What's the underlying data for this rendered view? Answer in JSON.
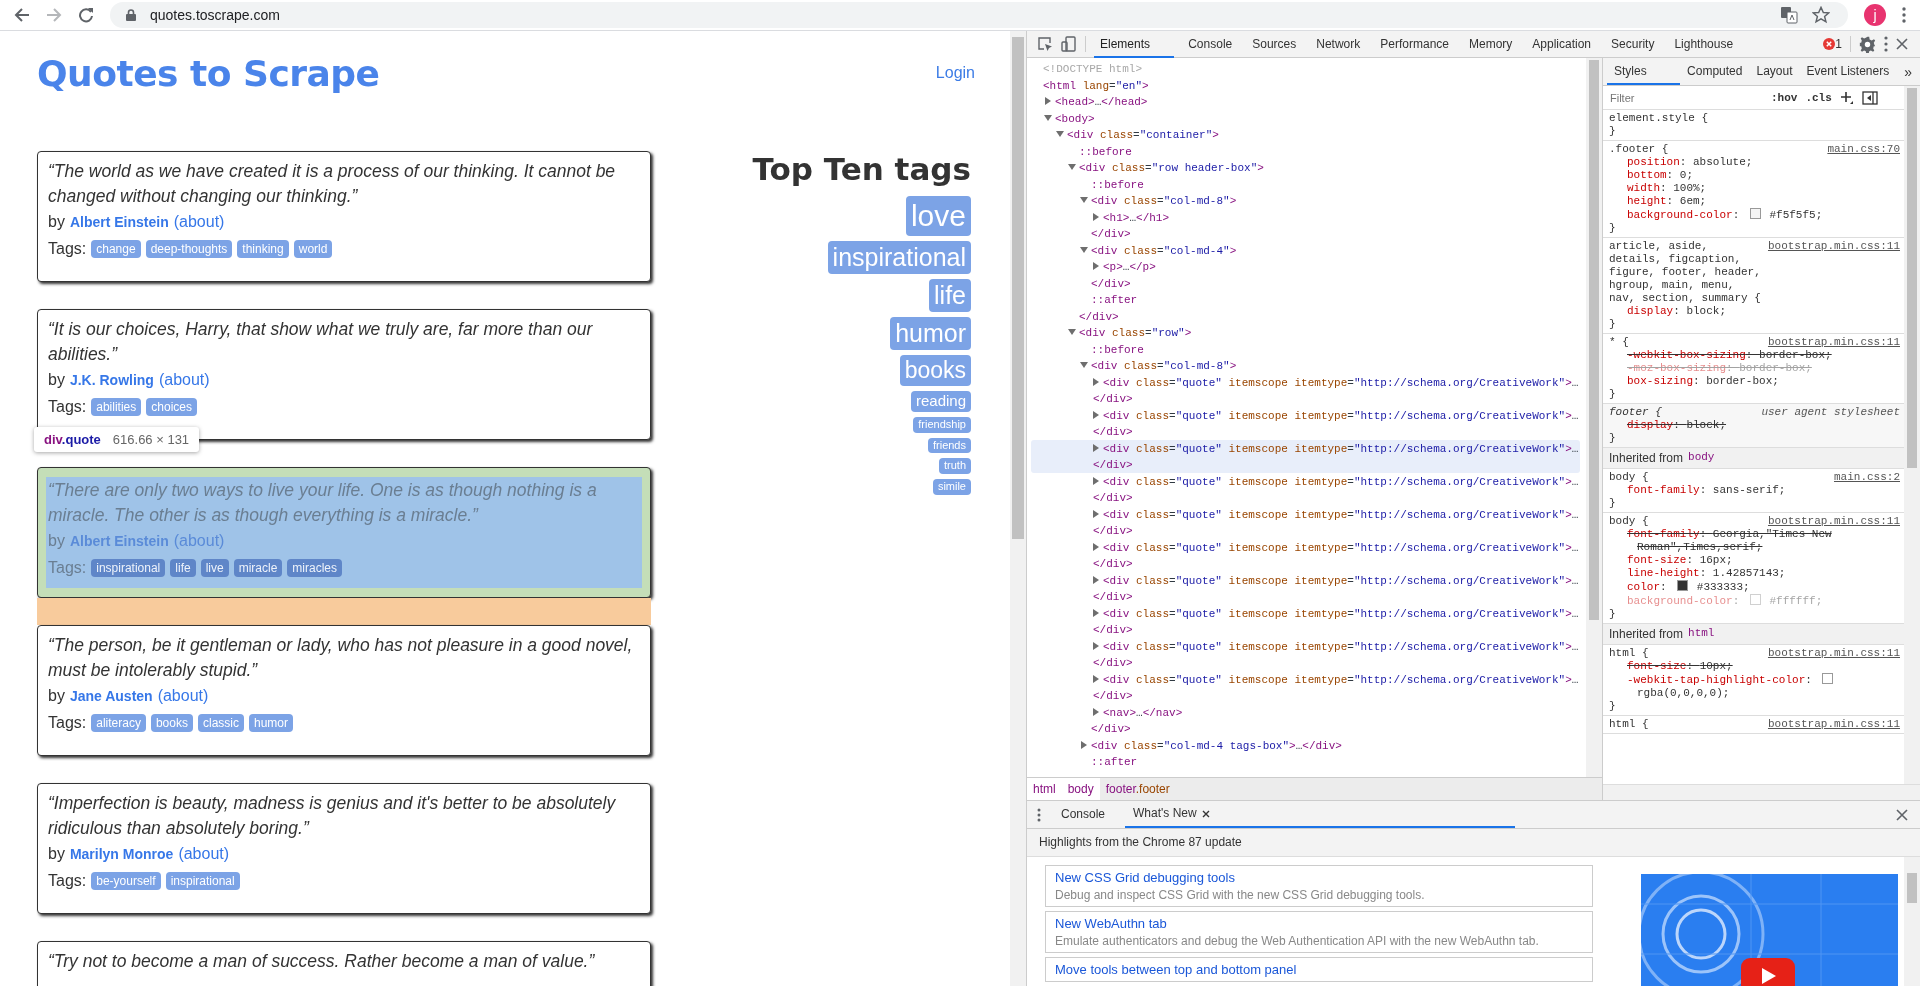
{
  "browser": {
    "nav_buttons": [
      {
        "kind": "back",
        "disabled": false
      },
      {
        "kind": "forward",
        "disabled": true
      },
      {
        "kind": "reload",
        "disabled": false
      }
    ],
    "url": "quotes.toscrape.com",
    "avatar": "j"
  },
  "page": {
    "title": "Quotes to Scrape",
    "login": "Login",
    "quotes": [
      {
        "text": "“The world as we have created it is a process of our thinking. It cannot be changed without changing our thinking.”",
        "by": "by",
        "author": "Albert Einstein",
        "about": "(about)",
        "tags_label": "Tags:",
        "tags": [
          "change",
          "deep-thoughts",
          "thinking",
          "world"
        ],
        "highlighted": false
      },
      {
        "text": "“It is our choices, Harry, that show what we truly are, far more than our abilities.”",
        "by": "by",
        "author": "J.K. Rowling",
        "about": "(about)",
        "tags_label": "Tags:",
        "tags": [
          "abilities",
          "choices"
        ],
        "highlighted": false
      },
      {
        "text": "“There are only two ways to live your life. One is as though nothing is a miracle. The other is as though everything is a miracle.”",
        "by": "by",
        "author": "Albert Einstein",
        "about": "(about)",
        "tags_label": "Tags:",
        "tags": [
          "inspirational",
          "life",
          "live",
          "miracle",
          "miracles"
        ],
        "highlighted": true
      },
      {
        "text": "“The person, be it gentleman or lady, who has not pleasure in a good novel, must be intolerably stupid.”",
        "by": "by",
        "author": "Jane Austen",
        "about": "(about)",
        "tags_label": "Tags:",
        "tags": [
          "aliteracy",
          "books",
          "classic",
          "humor"
        ],
        "highlighted": false
      },
      {
        "text": "“Imperfection is beauty, madness is genius and it's better to be absolutely ridiculous than absolutely boring.”",
        "by": "by",
        "author": "Marilyn Monroe",
        "about": "(about)",
        "tags_label": "Tags:",
        "tags": [
          "be-yourself",
          "inspirational"
        ],
        "highlighted": false
      },
      {
        "text": "“Try not to become a man of success. Rather become a man of value.”",
        "highlighted": false
      }
    ],
    "inspect_tooltip": {
      "selector": "div.quote",
      "size": "616.66 × 131"
    },
    "top_tags": {
      "title": "Top Ten tags",
      "tags": [
        "love",
        "inspirational",
        "life",
        "humor",
        "books",
        "reading",
        "friendship",
        "friends",
        "truth",
        "simile"
      ]
    }
  },
  "devtools": {
    "tabs": [
      {
        "label": "Elements",
        "selected": true
      },
      {
        "label": "Console",
        "selected": false
      },
      {
        "label": "Sources",
        "selected": false
      },
      {
        "label": "Network",
        "selected": false
      },
      {
        "label": "Performance",
        "selected": false
      },
      {
        "label": "Memory",
        "selected": false
      },
      {
        "label": "Application",
        "selected": false
      },
      {
        "label": "Security",
        "selected": false
      },
      {
        "label": "Lighthouse",
        "selected": false
      }
    ],
    "error_count": "1",
    "elements": {
      "nodes": [
        {
          "kind": "doctype",
          "text": "<!DOCTYPE html>"
        },
        {
          "kind": "root",
          "text": "<html lang=\"en\">",
          "children": [
            {
              "kind": "element",
              "text": "<head>…</head>",
              "expanded": false
            },
            {
              "kind": "element",
              "text": "<body>",
              "expanded": true,
              "children": [
                {
                  "kind": "element",
                  "text": "<div class=\"container\">",
                  "expanded": true,
                  "children": [
                    {
                      "kind": "pseudo",
                      "text": "::before"
                    },
                    {
                      "kind": "element",
                      "text": "<div class=\"row header-box\">",
                      "expanded": true,
                      "close": "</div>",
                      "children": [
                        {
                          "kind": "pseudo",
                          "text": "::before"
                        },
                        {
                          "kind": "element",
                          "text": "<div class=\"col-md-8\">",
                          "expanded": true,
                          "close": "</div>",
                          "children": [
                            {
                              "kind": "element",
                              "text": "<h1>…</h1>",
                              "expanded": false
                            }
                          ]
                        },
                        {
                          "kind": "element",
                          "text": "<div class=\"col-md-4\">",
                          "expanded": true,
                          "close": "</div>",
                          "children": [
                            {
                              "kind": "element",
                              "text": "<p>…</p>",
                              "expanded": false
                            }
                          ]
                        },
                        {
                          "kind": "pseudo",
                          "text": "::after"
                        }
                      ]
                    },
                    {
                      "kind": "element",
                      "text": "<div class=\"row\">",
                      "expanded": true,
                      "children": [
                        {
                          "kind": "pseudo",
                          "text": "::before"
                        },
                        {
                          "kind": "element",
                          "text": "<div class=\"col-md-8\">",
                          "expanded": true,
                          "close": "</div>",
                          "children": [
                            {
                              "kind": "element",
                              "text": "<div class=\"quote\" itemscope itemtype=\"http://schema.org/CreativeWork\">…",
                              "close": "</div>",
                              "expanded": false,
                              "hovered": false
                            },
                            {
                              "kind": "element",
                              "text": "<div class=\"quote\" itemscope itemtype=\"http://schema.org/CreativeWork\">…",
                              "close": "</div>",
                              "expanded": false,
                              "hovered": false
                            },
                            {
                              "kind": "element",
                              "text": "<div class=\"quote\" itemscope itemtype=\"http://schema.org/CreativeWork\">…",
                              "close": "</div>",
                              "expanded": false,
                              "hovered": true
                            },
                            {
                              "kind": "element",
                              "text": "<div class=\"quote\" itemscope itemtype=\"http://schema.org/CreativeWork\">…",
                              "close": "</div>",
                              "expanded": false,
                              "hovered": false
                            },
                            {
                              "kind": "element",
                              "text": "<div class=\"quote\" itemscope itemtype=\"http://schema.org/CreativeWork\">…",
                              "close": "</div>",
                              "expanded": false,
                              "hovered": false
                            },
                            {
                              "kind": "element",
                              "text": "<div class=\"quote\" itemscope itemtype=\"http://schema.org/CreativeWork\">…",
                              "close": "</div>",
                              "expanded": false,
                              "hovered": false
                            },
                            {
                              "kind": "element",
                              "text": "<div class=\"quote\" itemscope itemtype=\"http://schema.org/CreativeWork\">…",
                              "close": "</div>",
                              "expanded": false,
                              "hovered": false
                            },
                            {
                              "kind": "element",
                              "text": "<div class=\"quote\" itemscope itemtype=\"http://schema.org/CreativeWork\">…",
                              "close": "</div>",
                              "expanded": false,
                              "hovered": false
                            },
                            {
                              "kind": "element",
                              "text": "<div class=\"quote\" itemscope itemtype=\"http://schema.org/CreativeWork\">…",
                              "close": "</div>",
                              "expanded": false,
                              "hovered": false
                            },
                            {
                              "kind": "element",
                              "text": "<div class=\"quote\" itemscope itemtype=\"http://schema.org/CreativeWork\">…",
                              "close": "</div>",
                              "expanded": false,
                              "hovered": false
                            },
                            {
                              "kind": "element",
                              "text": "<nav>…</nav>",
                              "expanded": false,
                              "hovered": false
                            }
                          ]
                        },
                        {
                          "kind": "element",
                          "text": "<div class=\"col-md-4 tags-box\">…</div>",
                          "expanded": false
                        },
                        {
                          "kind": "pseudo",
                          "text": "::after"
                        }
                      ]
                    }
                  ]
                }
              ]
            }
          ]
        }
      ]
    },
    "breadcrumbs": [
      {
        "label": "html",
        "selected": false
      },
      {
        "label": "body",
        "selected": false
      },
      {
        "label": "footer.footer",
        "selected": true
      }
    ],
    "styles": {
      "tabs": [
        {
          "label": "Styles",
          "selected": true
        },
        {
          "label": "Computed",
          "selected": false
        },
        {
          "label": "Layout",
          "selected": false
        },
        {
          "label": "Event Listeners",
          "selected": false
        }
      ],
      "more": "»",
      "filter_placeholder": "Filter",
      "hov": ":hov",
      "cls": ".cls",
      "sections": [
        {
          "kind": "rule",
          "selector": "element.style {",
          "close": "}"
        },
        {
          "kind": "rule",
          "selector": ".footer {",
          "source": "main.css:70",
          "close": "}",
          "decls": [
            {
              "text": "position: absolute;",
              "struck": false,
              "inactive": false
            },
            {
              "text": "bottom: 0;",
              "struck": false,
              "inactive": false
            },
            {
              "text": "width: 100%;",
              "struck": false,
              "inactive": false
            },
            {
              "text": "height: 6em;",
              "struck": false,
              "inactive": false
            },
            {
              "text": "background-color: #f5f5f5;",
              "color": "#f5f5f5",
              "struck": false,
              "inactive": false
            }
          ]
        },
        {
          "kind": "rule",
          "selector": "article, aside, details, figcaption, figure, footer, header, hgroup, main, menu, nav, section, summary {",
          "source": "bootstrap.min.css:11",
          "close": "}",
          "decls": [
            {
              "text": "display: block;",
              "struck": false,
              "inactive": false
            }
          ]
        },
        {
          "kind": "rule",
          "selector": "* {",
          "source": "bootstrap.min.css:11",
          "close": "}",
          "decls": [
            {
              "text": "-webkit-box-sizing: border-box;",
              "struck": true,
              "inactive": false
            },
            {
              "text": "-moz-box-sizing: border-box;",
              "struck": true,
              "inactive": true
            },
            {
              "text": "box-sizing: border-box;",
              "struck": false,
              "inactive": false
            }
          ]
        },
        {
          "kind": "user-agent",
          "selector": "footer {",
          "source": "user agent stylesheet",
          "close": "}",
          "decls": [
            {
              "text": "display: block;",
              "struck": true,
              "inactive": false
            }
          ]
        },
        {
          "kind": "inherited",
          "label": "Inherited from",
          "from": "body"
        },
        {
          "kind": "rule",
          "selector": "body {",
          "source": "main.css:2",
          "close": "}",
          "decls": [
            {
              "text": "font-family: sans-serif;",
              "struck": false,
              "inactive": false
            }
          ]
        },
        {
          "kind": "rule",
          "selector": "body {",
          "source": "bootstrap.min.css:11",
          "close": "}",
          "decls": [
            {
              "text": "font-family: Georgia,\"Times New Roman\",Times,serif;",
              "struck": true,
              "inactive": false
            },
            {
              "text": "font-size: 16px;",
              "struck": false,
              "inactive": false
            },
            {
              "text": "line-height: 1.42857143;",
              "struck": false,
              "inactive": false
            },
            {
              "text": "color: #333333;",
              "color": "#333333",
              "struck": false,
              "inactive": false
            },
            {
              "text": "background-color: #ffffff;",
              "color": "#ffffff",
              "struck": false,
              "inactive": true
            }
          ]
        },
        {
          "kind": "inherited",
          "label": "Inherited from",
          "from": "html"
        },
        {
          "kind": "rule",
          "selector": "html {",
          "source": "bootstrap.min.css:11",
          "close": "}",
          "decls": [
            {
              "text": "font-size: 10px;",
              "struck": true,
              "inactive": false
            },
            {
              "text": "-webkit-tap-highlight-color: rgba(0,0,0,0);",
              "color": "#ffffff",
              "struck": false,
              "inactive": false
            }
          ]
        },
        {
          "kind": "rule",
          "selector": "html {",
          "source": "bootstrap.min.css:11"
        }
      ]
    },
    "drawer": {
      "tabs": [
        {
          "label": "Console",
          "selected": false,
          "closable": false
        },
        {
          "label": "What's New",
          "selected": true,
          "closable": true
        }
      ],
      "heading": "Highlights from the Chrome 87 update",
      "cards": [
        {
          "title": "New CSS Grid debugging tools",
          "description": "Debug and inspect CSS Grid with the new CSS Grid debugging tools."
        },
        {
          "title": "New WebAuthn tab",
          "description": "Emulate authenticators and debug the Web Authentication API with the new WebAuthn tab."
        },
        {
          "title": "Move tools between top and bottom panel"
        }
      ]
    }
  }
}
